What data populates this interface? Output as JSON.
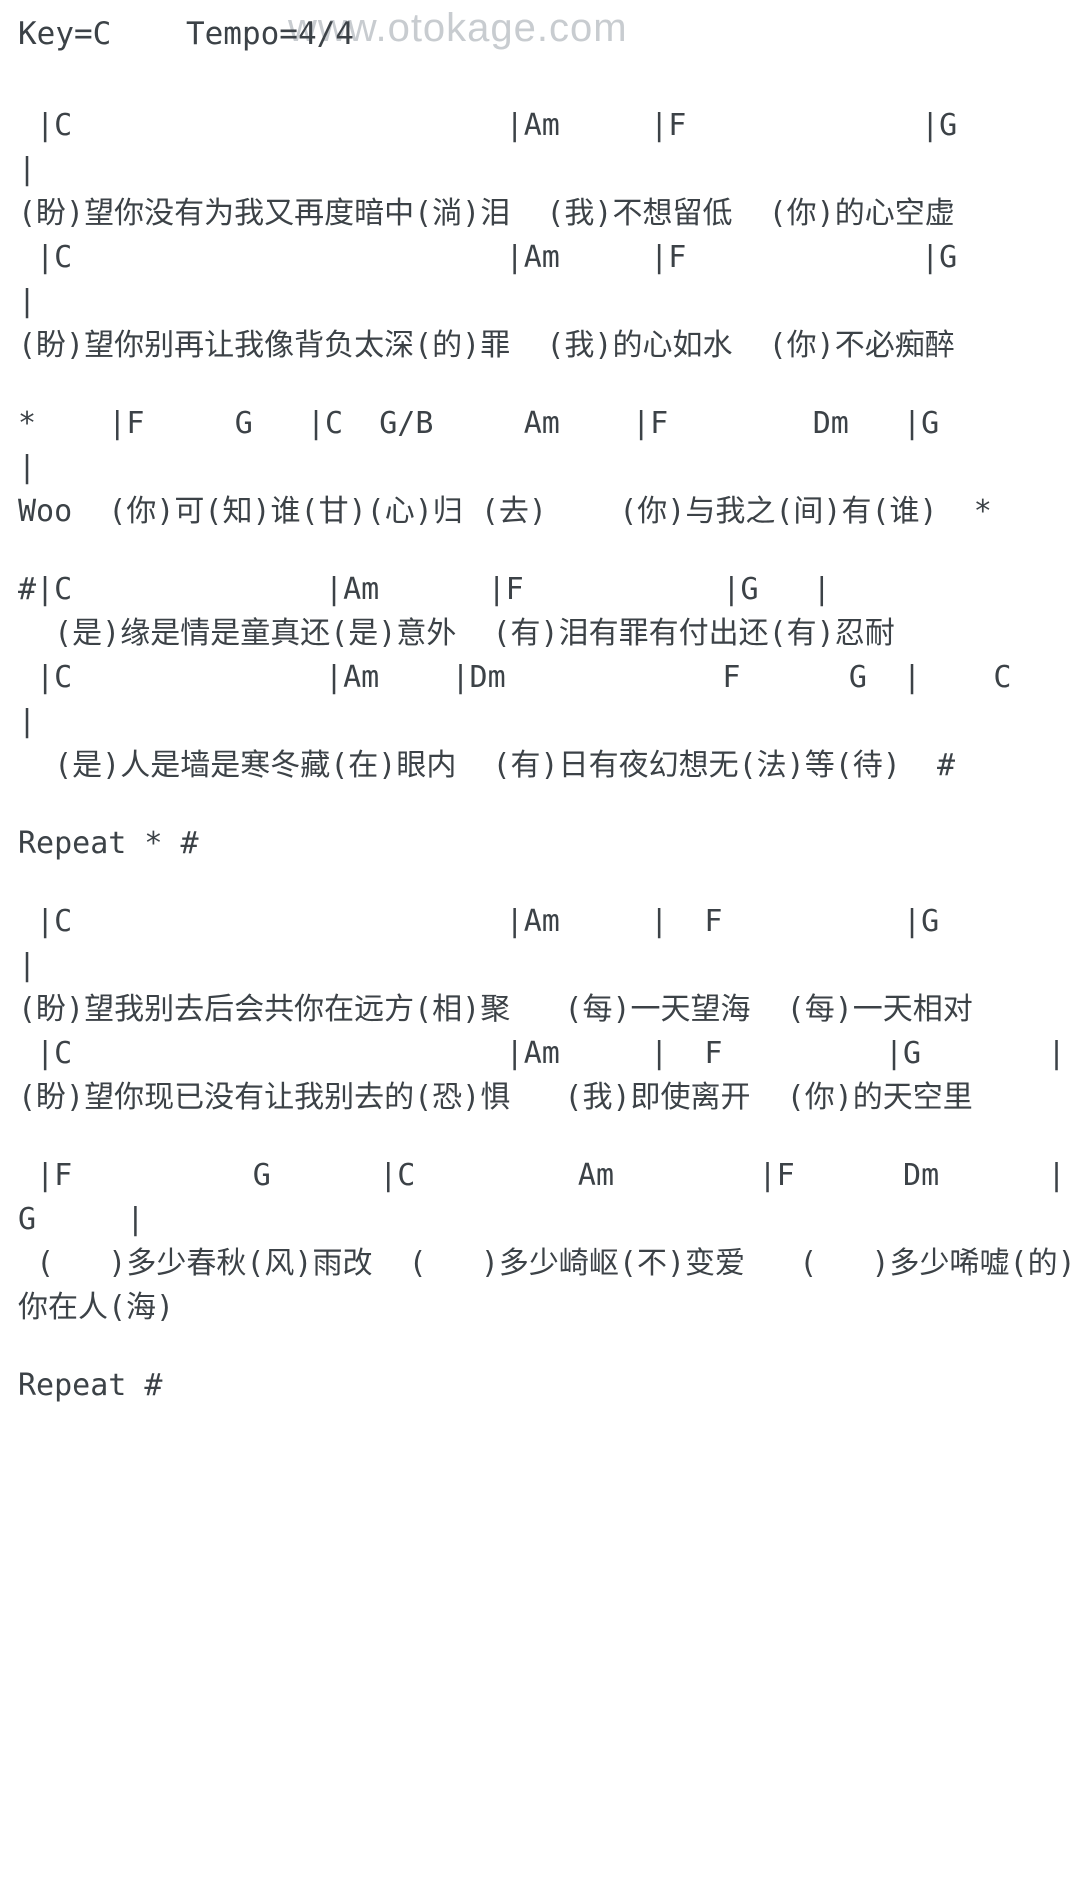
{
  "watermark": {
    "text": "www.otokage.com"
  },
  "header": {
    "meta": "Key=C    Tempo=4/4",
    "key_label": "Key=C",
    "tempo_label": "Tempo=4/4"
  },
  "sections": [
    {
      "name": "verse-1",
      "lines": [
        {
          "type": "chords",
          "text": " |C                        |Am     |F             |G       |"
        },
        {
          "type": "lyrics",
          "text": "(盼)望你没有为我又再度暗中(淌)泪  (我)不想留低  (你)的心空虚"
        },
        {
          "type": "chords",
          "text": " |C                        |Am     |F             |G       |"
        },
        {
          "type": "lyrics",
          "text": "(盼)望你别再让我像背负太深(的)罪  (我)的心如水  (你)不必痴醉"
        }
      ]
    },
    {
      "name": "bridge-star",
      "lines": [
        {
          "type": "chords",
          "text": "*    |F     G   |C  G/B     Am    |F        Dm   |G        |"
        },
        {
          "type": "lyrics",
          "text": "Woo  (你)可(知)谁(甘)(心)归 (去)    (你)与我之(间)有(谁)  *"
        }
      ]
    },
    {
      "name": "chorus-hash",
      "lines": [
        {
          "type": "chords",
          "text": "#|C              |Am      |F           |G   |"
        },
        {
          "type": "lyrics",
          "text": "  (是)缘是情是童真还(是)意外  (有)泪有罪有付出还(有)忍耐"
        },
        {
          "type": "chords",
          "text": " |C              |Am    |Dm            F      G  |    C    |"
        },
        {
          "type": "lyrics",
          "text": "  (是)人是墙是寒冬藏(在)眼内  (有)日有夜幻想无(法)等(待)  #"
        }
      ]
    },
    {
      "name": "repeat-1",
      "lines": [
        {
          "type": "marker",
          "text": "Repeat * #"
        }
      ]
    },
    {
      "name": "verse-2",
      "lines": [
        {
          "type": "chords",
          "text": " |C                        |Am     |  F          |G       |"
        },
        {
          "type": "lyrics",
          "text": "(盼)望我别去后会共你在远方(相)聚   (每)一天望海  (每)一天相对"
        },
        {
          "type": "chords",
          "text": " |C                        |Am     |  F         |G       |"
        },
        {
          "type": "lyrics",
          "text": "(盼)望你现已没有让我别去的(恐)惧   (我)即使离开  (你)的天空里"
        }
      ]
    },
    {
      "name": "outro",
      "lines": [
        {
          "type": "chords",
          "text": " |F          G      |C         Am        |F      Dm      |G     |"
        },
        {
          "type": "lyrics",
          "text": " (   )多少春秋(风)雨改  (   )多少崎岖(不)变爱   (   )多少唏嘘(的)你在人(海)"
        }
      ]
    },
    {
      "name": "repeat-2",
      "lines": [
        {
          "type": "marker",
          "text": "Repeat #"
        }
      ]
    }
  ],
  "colors": {
    "text": "#3c4247",
    "watermark": "#c8ccd0",
    "background": "#ffffff"
  }
}
